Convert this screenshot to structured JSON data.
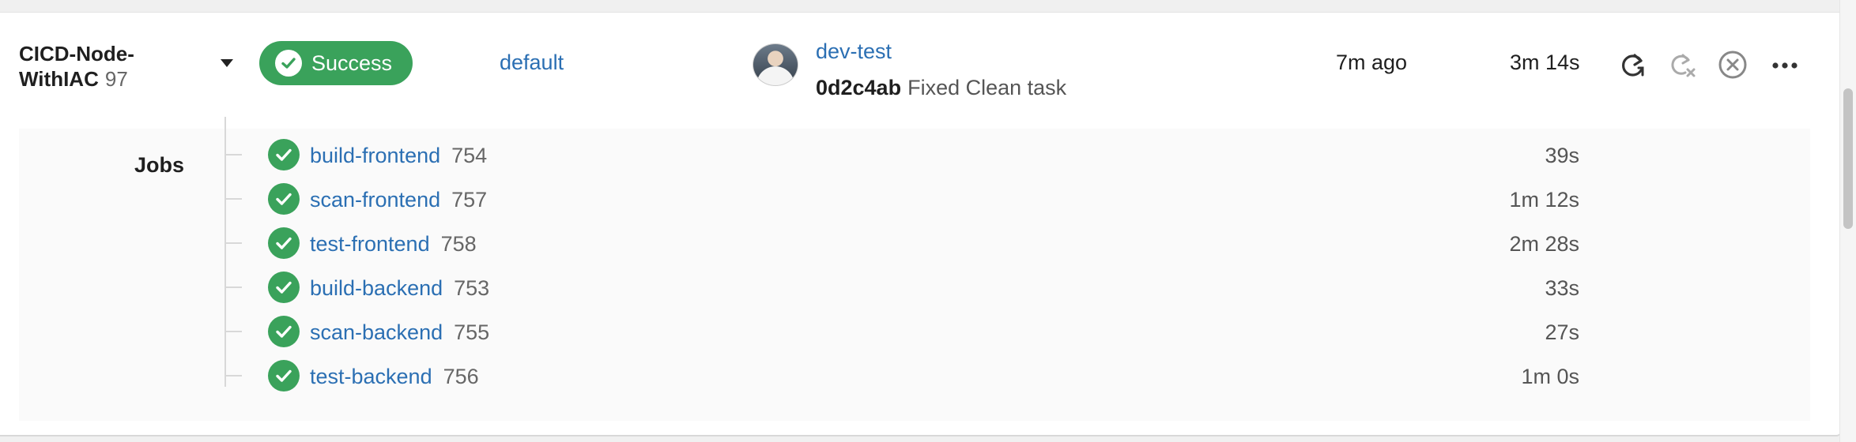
{
  "pipeline": {
    "name": "CICD-Node-WithIAC",
    "number": "97",
    "status": "Success",
    "branch": "default",
    "user": "dev-test",
    "commit_sha": "0d2c4ab",
    "commit_message": "Fixed Clean task",
    "started_ago": "7m ago",
    "duration": "3m 14s"
  },
  "actions": [
    "refresh-icon",
    "cancel-retry-icon",
    "stop-icon",
    "more-icon"
  ],
  "jobs": {
    "label": "Jobs",
    "items": [
      {
        "name": "build-frontend",
        "id": "754",
        "duration": "39s"
      },
      {
        "name": "scan-frontend",
        "id": "757",
        "duration": "1m 12s"
      },
      {
        "name": "test-frontend",
        "id": "758",
        "duration": "2m 28s"
      },
      {
        "name": "build-backend",
        "id": "753",
        "duration": "33s"
      },
      {
        "name": "scan-backend",
        "id": "755",
        "duration": "27s"
      },
      {
        "name": "test-backend",
        "id": "756",
        "duration": "1m 0s"
      }
    ]
  },
  "colors": {
    "success": "#3aa25b",
    "link": "#2b6fb3"
  }
}
